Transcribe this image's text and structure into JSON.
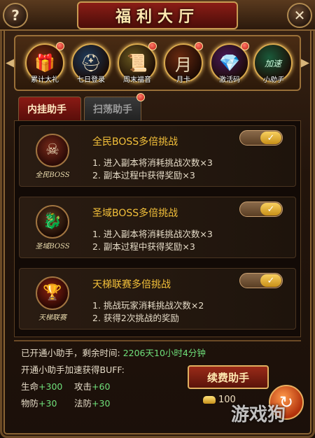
{
  "window": {
    "title": "福利大厅",
    "help_label": "?",
    "close_label": "✕"
  },
  "icon_strip": {
    "items": [
      {
        "caption": "累计大礼",
        "icon": "gift-box-icon",
        "glyph": "🎁",
        "bg": "#7a2a10",
        "badge": true
      },
      {
        "caption": "七日登录",
        "icon": "warrior-helmet-icon",
        "glyph": "⛑",
        "bg": "#1e3a5a",
        "badge": false
      },
      {
        "caption": "周末福音",
        "icon": "scroll-icon",
        "glyph": "📜",
        "bg": "#6a5a20",
        "badge": true
      },
      {
        "caption": "月卡",
        "icon": "month-card-icon",
        "glyph": "月",
        "bg": "#6a2a10",
        "badge": true
      },
      {
        "caption": "激活码",
        "icon": "crystal-icon",
        "glyph": "💎",
        "bg": "#4a1a5a",
        "badge": true
      },
      {
        "caption": "小助手",
        "icon": "helper-card-icon",
        "glyph": "加速",
        "bg": "#1a5a3a",
        "badge": false
      }
    ]
  },
  "tabs": [
    {
      "label": "内挂助手",
      "active": true
    },
    {
      "label": "扫荡助手",
      "active": false
    }
  ],
  "cards": [
    {
      "title": "全民BOSS多倍挑战",
      "emblem": "全民BOSS",
      "emblem_icon": "demon-skull-icon",
      "glyph": "☠",
      "lines": [
        "1. 进入副本将消耗挑战次数×3",
        "2. 副本过程中获得奖励×3"
      ],
      "enabled": true
    },
    {
      "title": "圣域BOSS多倍挑战",
      "emblem": "圣域BOSS",
      "emblem_icon": "dragon-head-icon",
      "glyph": "🐉",
      "lines": [
        "1. 进入副本将消耗挑战次数×3",
        "2. 副本过程中获得奖励×3"
      ],
      "enabled": true
    },
    {
      "title": "天梯联赛多倍挑战",
      "emblem": "天梯联赛",
      "emblem_icon": "trophy-icon",
      "glyph": "🏆",
      "lines": [
        "1. 挑战玩家消耗挑战次数×2",
        "2. 获得2次挑战的奖励"
      ],
      "enabled": true
    }
  ],
  "status": {
    "opened_label": "已开通小助手，剩余时间:",
    "remaining": "2206天10小时4分钟",
    "buff_label": "开通小助手加速获得BUFF:",
    "stats": [
      {
        "name": "生命",
        "value": "+300"
      },
      {
        "name": "攻击",
        "value": "+60"
      },
      {
        "name": "物防",
        "value": "+30"
      },
      {
        "name": "法防",
        "value": "+30"
      }
    ]
  },
  "renew": {
    "label": "续费助手",
    "cost": "100"
  },
  "watermark": "游戏狗",
  "colors": {
    "gold_title": "#f3c03a",
    "green_value": "#6fe07a",
    "frame_border": "#8a6434"
  }
}
